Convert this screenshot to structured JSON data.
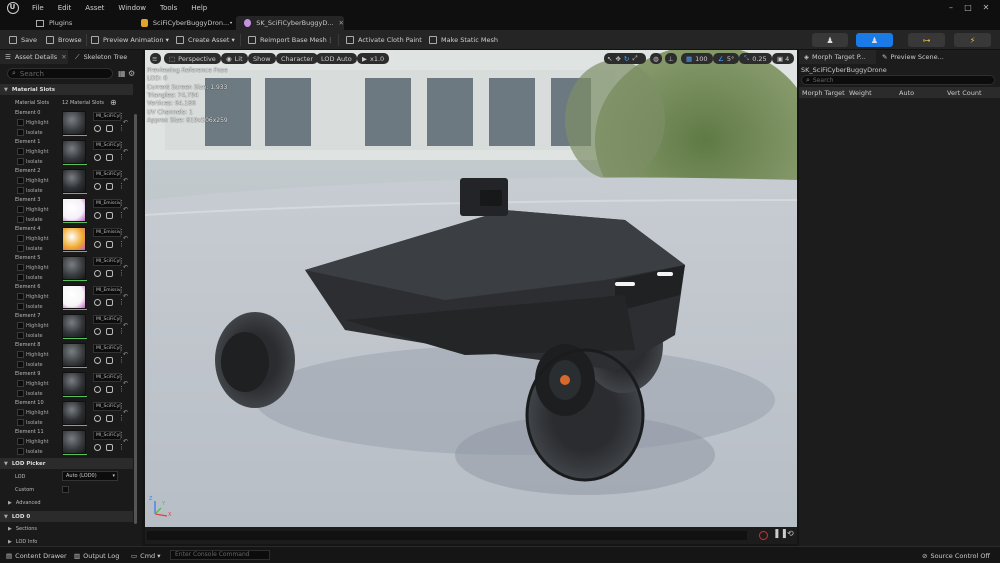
{
  "menu": {
    "items": [
      "File",
      "Edit",
      "Asset",
      "Window",
      "Tools",
      "Help"
    ]
  },
  "tabs": {
    "plugins": "Plugins",
    "doc1": "SciFiCyberBuggyDron...•",
    "doc2": "SK_SciFiCyberBuggyD..."
  },
  "toolbar": {
    "save": "Save",
    "browse": "Browse",
    "preview_animation": "Preview Animation ▾",
    "create_asset": "Create Asset ▾",
    "reimport": "Reimport Base Mesh",
    "cloth_paint": "Activate Cloth Paint",
    "static_mesh": "Make Static Mesh"
  },
  "left_panel": {
    "tab_details": "Asset Details",
    "tab_skeleton": "Skeleton Tree",
    "search_placeholder": "Search",
    "material_slots_header": "Material Slots",
    "material_slots_label": "Material Slots",
    "material_slots_count": "12 Material Slots",
    "highlight": "Highlight",
    "isolate": "Isolate",
    "elements": [
      {
        "label": "Element 0",
        "material": "MI_SciFiCyb"
      },
      {
        "label": "Element 1",
        "material": "MI_SciFiCyb"
      },
      {
        "label": "Element 2",
        "material": "MI_SciFiCyb"
      },
      {
        "label": "Element 3",
        "material": "MI_Emissive"
      },
      {
        "label": "Element 4",
        "material": "MI_Emissive"
      },
      {
        "label": "Element 5",
        "material": "MI_SciFiCyb"
      },
      {
        "label": "Element 6",
        "material": "MI_Emissive"
      },
      {
        "label": "Element 7",
        "material": "MI_SciFiCyb"
      },
      {
        "label": "Element 8",
        "material": "MI_SciFiCyb"
      },
      {
        "label": "Element 9",
        "material": "MI_SciFiCyb"
      },
      {
        "label": "Element 10",
        "material": "MI_SciFiCyb"
      },
      {
        "label": "Element 11",
        "material": "MI_SciFiCyb"
      }
    ],
    "lod_picker_header": "LOD Picker",
    "lod_label": "LOD",
    "lod_value": "Auto (LOD0)",
    "custom_label": "Custom",
    "advanced": "Advanced",
    "lod0_header": "LOD 0",
    "sections": "Sections",
    "lod_info": "LOD Info"
  },
  "viewport": {
    "perspective": "Perspective",
    "lit": "Lit",
    "show": "Show",
    "character": "Character",
    "lod_auto": "LOD Auto",
    "speed": "x1.0",
    "grid_value": "100",
    "angle_value": "5°",
    "scale_value": "0.25",
    "cam_value": "4",
    "stats": [
      "Previewing Reference Pose",
      "LOD: 0",
      "Current Screen Size: 1.933",
      "Triangles: 74,794",
      "Vertices: 64,186",
      "UV Channels: 1",
      "Approx Size: 819x506x259"
    ],
    "axis_x": "X",
    "axis_y": "Y",
    "axis_z": "Z"
  },
  "right_panel": {
    "tab_morph": "Morph Target P...",
    "tab_preview": "Preview Scene...",
    "mesh_name": "SK_SciFiCyberBuggyDrone",
    "search_placeholder": "Search",
    "columns": [
      "Morph Target",
      "Weight",
      "Auto",
      "Vert Count"
    ]
  },
  "statusbar": {
    "content_drawer": "Content Drawer",
    "output_log": "Output Log",
    "cmd": "Cmd ▾",
    "console_placeholder": "Enter Console Command",
    "source_control": "Source Control Off"
  },
  "colors": {
    "accent_blue": "#1a7be6",
    "material_green": "#59c15a",
    "panel_bg": "#1a1a1a"
  }
}
